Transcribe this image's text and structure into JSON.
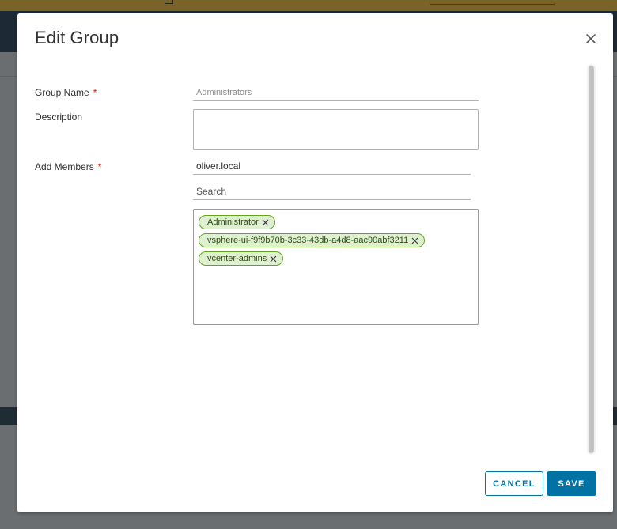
{
  "dialog": {
    "title": "Edit Group",
    "close_icon": "close-icon"
  },
  "form": {
    "group_name": {
      "label": "Group Name",
      "required_mark": "*",
      "value": "Administrators"
    },
    "description": {
      "label": "Description",
      "value": ""
    },
    "add_members": {
      "label": "Add Members",
      "required_mark": "*",
      "value": "oliver.local",
      "search_placeholder": "Search",
      "members": [
        {
          "name": "Administrator"
        },
        {
          "name": "vsphere-ui-f9f9b70b-3c33-43db-a4d8-aac90abf3211"
        },
        {
          "name": "vcenter-admins"
        }
      ]
    }
  },
  "footer": {
    "cancel_label": "CANCEL",
    "save_label": "SAVE"
  },
  "colors": {
    "primary": "#0072a3",
    "required": "#c92100",
    "chip_bg": "#dff0d0",
    "chip_border": "#62a420"
  }
}
